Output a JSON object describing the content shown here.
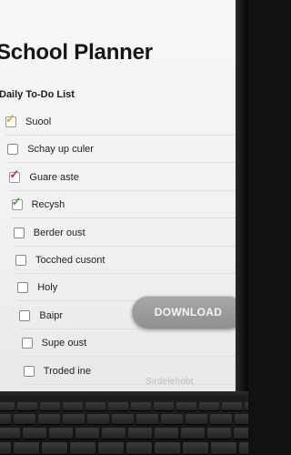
{
  "app": {
    "title": "School Planner"
  },
  "todo_list": {
    "title": "Daily To-Do List",
    "items": [
      {
        "label": "Suool",
        "checked": true,
        "check_color": "#e0a21b"
      },
      {
        "label": "Schay up culer",
        "checked": false
      },
      {
        "label": "Guare aste",
        "checked": true,
        "check_color": "#d0223a"
      },
      {
        "label": "Recysh",
        "checked": true,
        "check_color": "#3aa845"
      },
      {
        "label": "Berder oust",
        "checked": false
      },
      {
        "label": "Tocched cusont",
        "checked": false
      },
      {
        "label": "Holy",
        "checked": false
      },
      {
        "label": "Baipr",
        "checked": false
      },
      {
        "label": "Supe oust",
        "checked": false
      },
      {
        "label": "Troded ine",
        "checked": false
      }
    ]
  },
  "download_button": {
    "label": "DOWNLOAD"
  },
  "device": {
    "brand_label": "Sirdelehobt"
  },
  "colors": {
    "button": "#9d9d9d",
    "screen_bg": "#f3f3f3"
  }
}
